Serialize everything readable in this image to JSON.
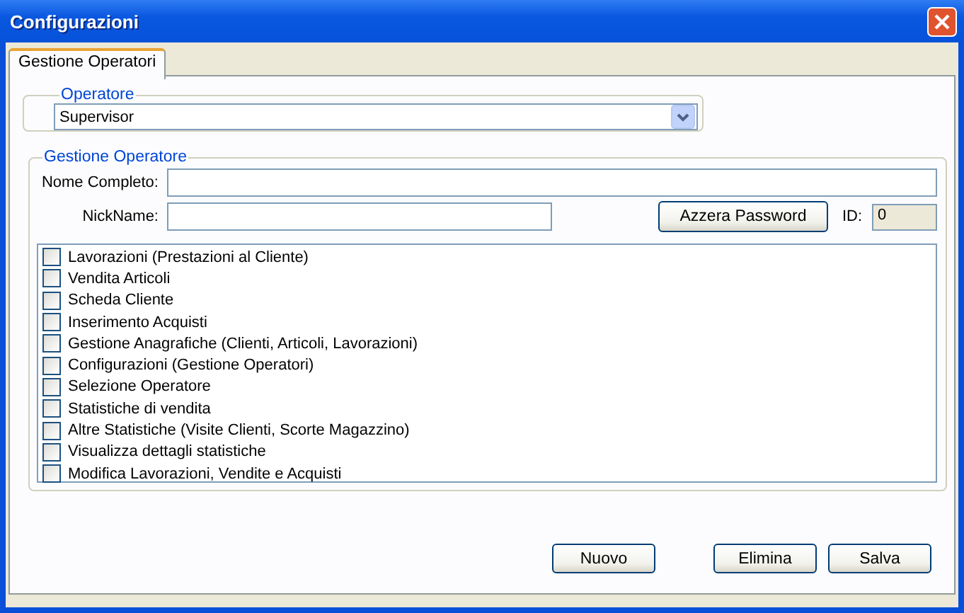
{
  "window": {
    "title": "Configurazioni"
  },
  "tabs": [
    {
      "label": "Gestione Operatori",
      "selected": true
    }
  ],
  "operator_group": {
    "legend": "Operatore",
    "dropdown": {
      "value": "Supervisor"
    }
  },
  "management_group": {
    "legend": "Gestione Operatore",
    "full_name": {
      "label": "Nome Completo:"
    },
    "nickname": {
      "label": "NickName:"
    },
    "reset_button": "Azzera Password",
    "id": {
      "label": "ID:",
      "value": "0"
    },
    "permissions": [
      {
        "label": "Lavorazioni (Prestazioni al Cliente)",
        "checked": false
      },
      {
        "label": "Vendita Articoli",
        "checked": false
      },
      {
        "label": "Scheda Cliente",
        "checked": false
      },
      {
        "label": "Inserimento Acquisti",
        "checked": false
      },
      {
        "label": "Gestione Anagrafiche (Clienti, Articoli, Lavorazioni)",
        "checked": false
      },
      {
        "label": "Configurazioni (Gestione Operatori)",
        "checked": false
      },
      {
        "label": "Selezione Operatore",
        "checked": false
      },
      {
        "label": "Statistiche di vendita",
        "checked": false
      },
      {
        "label": "Altre Statistiche (Visite Clienti, Scorte Magazzino)",
        "checked": false
      },
      {
        "label": "Visualizza dettagli statistiche",
        "checked": false
      },
      {
        "label": "Modifica Lavorazioni, Vendite e Acquisti",
        "checked": false
      }
    ]
  },
  "buttons": [
    "Nuovo",
    "Elimina",
    "Salva"
  ]
}
